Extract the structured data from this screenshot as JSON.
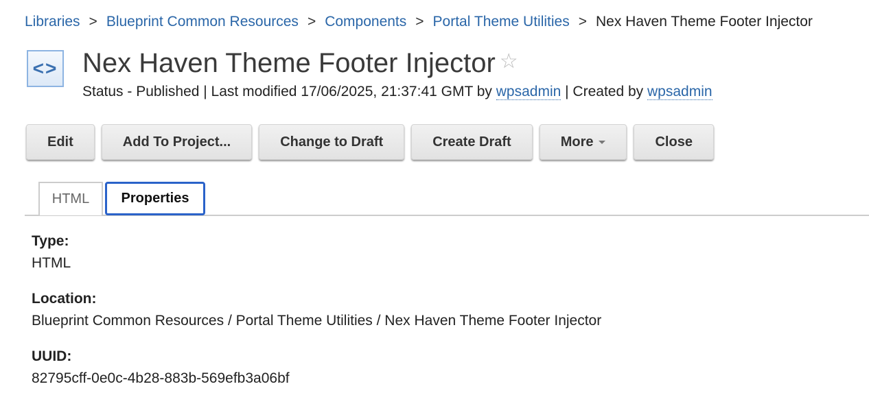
{
  "breadcrumb": [
    "Libraries",
    "Blueprint Common Resources",
    "Components",
    "Portal Theme Utilities"
  ],
  "breadcrumb_current": "Nex Haven Theme Footer Injector",
  "breadcrumb_sep": ">",
  "header": {
    "icon_glyph": "<>",
    "title": "Nex Haven Theme Footer Injector",
    "status_text": "Status - Published | Last modified 17/06/2025, 21:37:41 GMT by ",
    "modified_by": "wpsadmin",
    "created_text": " | Created by ",
    "created_by": "wpsadmin"
  },
  "toolbar": {
    "edit": "Edit",
    "add_to_project": "Add To Project...",
    "change_to_draft": "Change to Draft",
    "create_draft": "Create Draft",
    "more": "More",
    "close": "Close"
  },
  "tabs": {
    "html": "HTML",
    "properties": "Properties"
  },
  "properties": [
    {
      "label": "Type:",
      "value": "HTML"
    },
    {
      "label": "Location:",
      "value": "Blueprint Common Resources / Portal Theme Utilities / Nex Haven Theme Footer Injector"
    },
    {
      "label": "UUID:",
      "value": "82795cff-0e0c-4b28-883b-569efb3a06bf"
    }
  ]
}
